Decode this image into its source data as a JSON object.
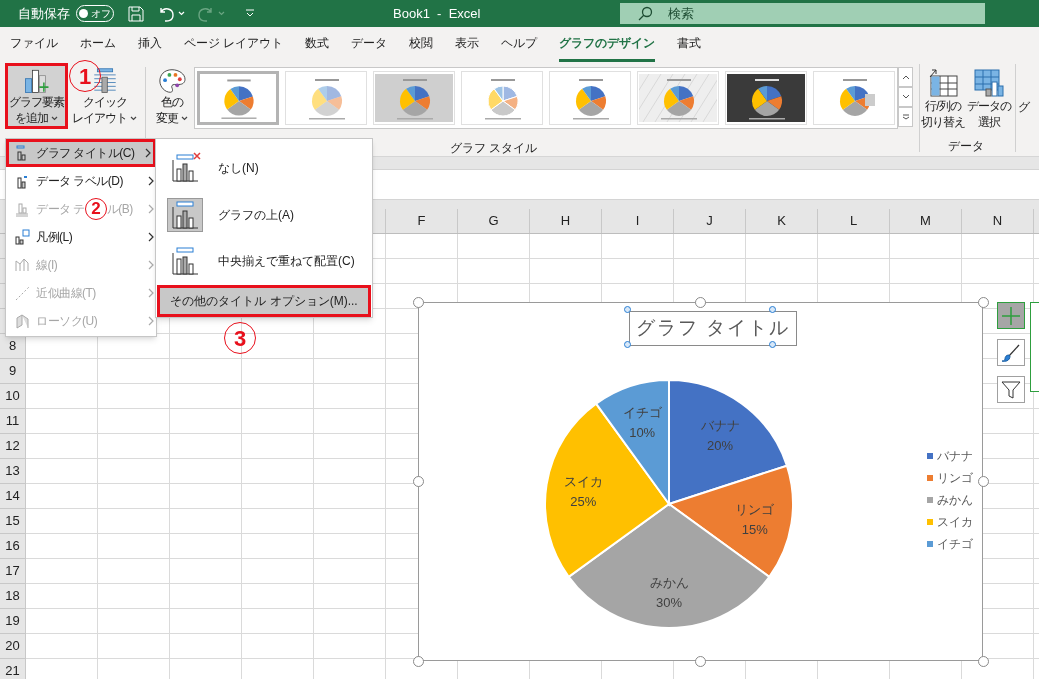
{
  "title_bar": {
    "autosave_label": "自動保存",
    "autosave_toggle": {
      "label": "オフ",
      "on": false
    },
    "document_title": "Book1  -  Excel",
    "search": {
      "placeholder": "検索"
    }
  },
  "tabs": [
    {
      "label": "ファイル",
      "selected": false
    },
    {
      "label": "ホーム",
      "selected": false
    },
    {
      "label": "挿入",
      "selected": false
    },
    {
      "label": "ページ レイアウト",
      "selected": false
    },
    {
      "label": "数式",
      "selected": false
    },
    {
      "label": "データ",
      "selected": false
    },
    {
      "label": "校閲",
      "selected": false
    },
    {
      "label": "表示",
      "selected": false
    },
    {
      "label": "ヘルプ",
      "selected": false
    },
    {
      "label": "グラフのデザイン",
      "selected": true
    },
    {
      "label": "書式",
      "selected": false
    }
  ],
  "ribbon": {
    "left_buttons": [
      {
        "kind": "add-element",
        "lines": [
          "グラフ要素",
          "を追加"
        ],
        "highlighted": true
      },
      {
        "kind": "quick-layout",
        "lines": [
          "クイック",
          "レイアウト"
        ],
        "highlighted": false
      },
      {
        "kind": "colors",
        "lines": [
          "色の",
          "変更"
        ],
        "highlighted": false
      }
    ],
    "styles": [
      {
        "kind": "plain",
        "selected": true
      },
      {
        "kind": "striped",
        "selected": false
      },
      {
        "kind": "shaded",
        "selected": false
      },
      {
        "kind": "light",
        "selected": false
      },
      {
        "kind": "plain",
        "selected": false
      },
      {
        "kind": "pattern",
        "selected": false
      },
      {
        "kind": "dark",
        "selected": false
      },
      {
        "kind": "labels",
        "selected": false
      }
    ],
    "styles_group_label": "グラフ スタイル",
    "data_buttons": [
      {
        "kind": "switch",
        "lines": [
          "行/列の",
          "切り替え"
        ]
      },
      {
        "kind": "select",
        "lines": [
          "データの",
          "選択"
        ]
      }
    ],
    "data_group_label": "データ",
    "cut_label": "グ"
  },
  "sheet": {
    "columns": [
      "F",
      "G",
      "H",
      "I",
      "J",
      "K",
      "L",
      "M",
      "N"
    ],
    "rows": [
      "8",
      "9",
      "10",
      "11",
      "12",
      "13",
      "14",
      "15",
      "16",
      "17",
      "18",
      "19",
      "20",
      "21"
    ]
  },
  "menu": {
    "items": [
      {
        "kind": "title",
        "label": "グラフ タイトル(C)",
        "selected": true,
        "disabled": false
      },
      {
        "kind": "data-label",
        "label": "データ ラベル(D)",
        "selected": false,
        "disabled": false
      },
      {
        "kind": "data-table",
        "label": "データ テ",
        "label_tail": "ル(B)",
        "selected": false,
        "disabled": true
      },
      {
        "kind": "legend",
        "label": "凡例(L)",
        "selected": false,
        "disabled": false
      },
      {
        "kind": "lines",
        "label": "線(I)",
        "selected": false,
        "disabled": true
      },
      {
        "kind": "trendline",
        "label": "近似曲線(T)",
        "selected": false,
        "disabled": true
      },
      {
        "kind": "updown",
        "label": "ローソク(U)",
        "selected": false,
        "disabled": true
      }
    ]
  },
  "submenu": {
    "items": [
      {
        "kind": "none",
        "label": "なし(N)",
        "selected": false
      },
      {
        "kind": "above",
        "label": "グラフの上(A)",
        "selected": true
      },
      {
        "kind": "overlay",
        "label": "中央揃えで重ねて配置(C)",
        "selected": false
      }
    ],
    "more_options": {
      "label": "その他のタイトル オプション(M)...",
      "highlighted": true
    }
  },
  "annotations": [
    {
      "label": "1"
    },
    {
      "label": "2"
    },
    {
      "label": "3"
    }
  ],
  "chart": {
    "chart_data": {
      "type": "pie",
      "title": "グラフ タイトル",
      "categories": [
        "バナナ",
        "リンゴ",
        "みかん",
        "スイカ",
        "イチゴ"
      ],
      "values": [
        20,
        15,
        30,
        25,
        10
      ],
      "colors": [
        "#4472c4",
        "#ed7d31",
        "#a5a5a5",
        "#ffc000",
        "#5b9bd5"
      ],
      "data_labels": true,
      "value_labels": [
        "20%",
        "15%",
        "30%",
        "25%",
        "10%"
      ]
    },
    "legend": [
      {
        "label": "バナナ",
        "color": "#4472c4"
      },
      {
        "label": "リンゴ",
        "color": "#ed7d31"
      },
      {
        "label": "みかん",
        "color": "#a5a5a5"
      },
      {
        "label": "スイカ",
        "color": "#ffc000"
      },
      {
        "label": "イチゴ",
        "color": "#5b9bd5"
      }
    ],
    "side_buttons": [
      {
        "kind": "elements",
        "selected": true
      },
      {
        "kind": "styles",
        "selected": false
      },
      {
        "kind": "filters",
        "selected": false
      }
    ]
  }
}
